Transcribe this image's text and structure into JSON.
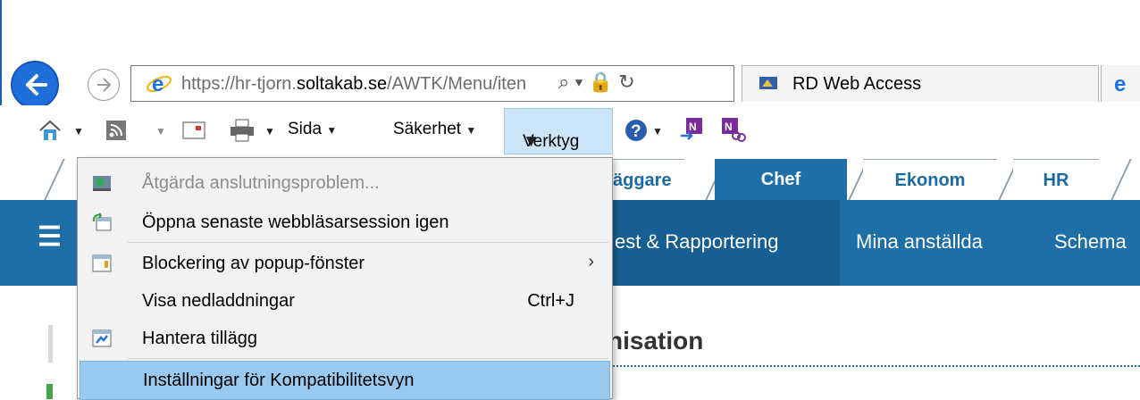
{
  "browser": {
    "url_prefix": "https://hr-tjorn.",
    "url_domain": "soltakab.se",
    "url_path": "/AWTK/Menu/iten",
    "address_icons": "⌕ ▾ 🔒 ↻",
    "tabs": [
      {
        "label": "RD Web Access",
        "icon": "rd-web-access-icon"
      }
    ]
  },
  "command_bar": {
    "sida_label": "Sida",
    "sakerhet_label": "Säkerhet",
    "verktyg_label": "Verktyg"
  },
  "tools_menu": {
    "items": [
      {
        "label": "Åtgärda anslutningsproblem...",
        "disabled": true,
        "icon": "network-diagnose-icon"
      },
      {
        "label": "Öppna senaste webbläsarsession igen",
        "icon": "reopen-session-icon"
      },
      {
        "label": "Blockering av popup-fönster",
        "submenu": true,
        "icon": "popup-blocker-icon"
      },
      {
        "label": "Visa nedladdningar",
        "shortcut": "Ctrl+J"
      },
      {
        "label": "Hantera tillägg",
        "icon": "manage-addons-icon"
      },
      {
        "label": "Inställningar för Kompatibilitetsvyn",
        "highlighted": true
      }
    ]
  },
  "app": {
    "role_tabs": [
      {
        "label": "äggare"
      },
      {
        "label": "Chef",
        "active": true
      },
      {
        "label": "Ekonom"
      },
      {
        "label": "HR"
      }
    ],
    "nav": [
      {
        "label": "est & Rapportering",
        "active": true
      },
      {
        "label": "Mina anställda"
      },
      {
        "label": "Schema"
      }
    ],
    "page_title": "nisation"
  },
  "colors": {
    "accent": "#1e6fa8",
    "menu_highlight": "#99c9ef",
    "verktyg_highlight": "#cce4f7"
  }
}
